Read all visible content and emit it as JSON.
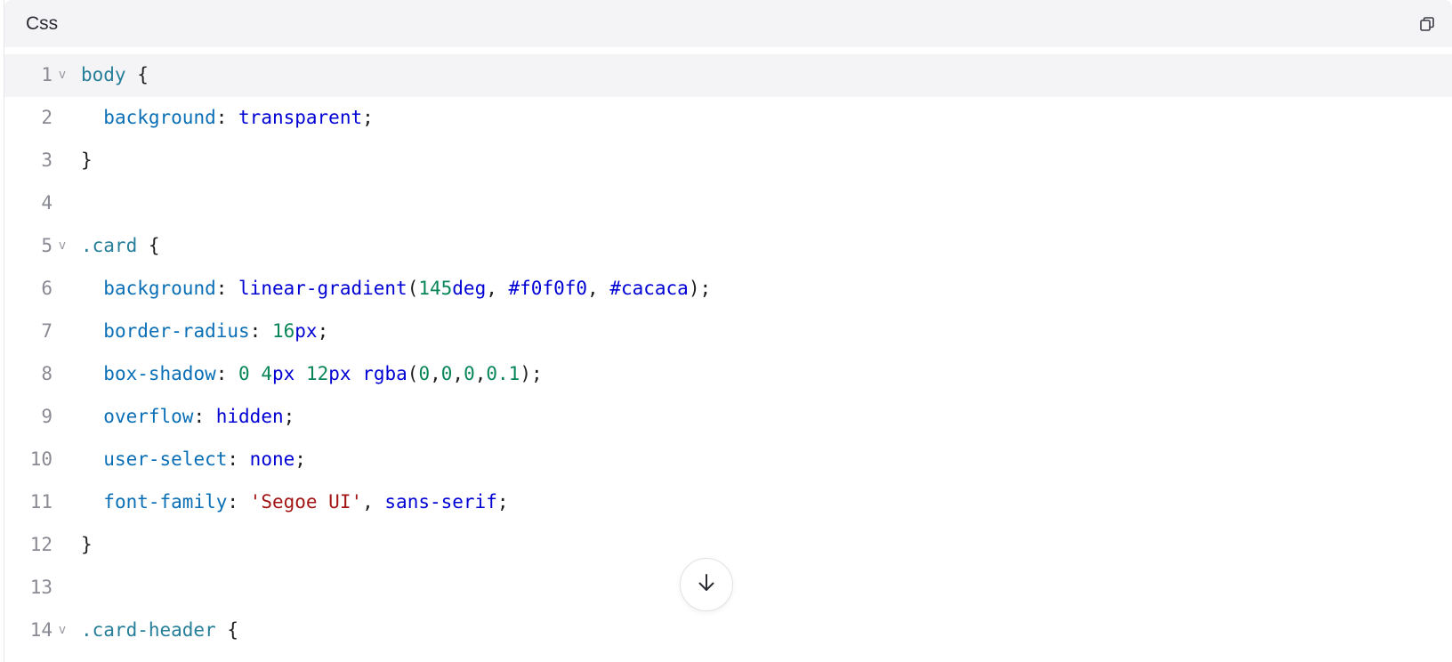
{
  "header": {
    "language": "Css",
    "copy_icon": "copy-icon"
  },
  "code": {
    "active_line": 1,
    "lines": [
      {
        "n": "1",
        "fold": true,
        "tokens": [
          [
            "sel",
            "body"
          ],
          [
            "pl",
            " {"
          ]
        ]
      },
      {
        "n": "2",
        "fold": false,
        "tokens": [
          [
            "pl",
            "  "
          ],
          [
            "prop",
            "background"
          ],
          [
            "pl",
            ": "
          ],
          [
            "kw",
            "transparent"
          ],
          [
            "pl",
            ";"
          ]
        ]
      },
      {
        "n": "3",
        "fold": false,
        "tokens": [
          [
            "pl",
            "}"
          ]
        ]
      },
      {
        "n": "4",
        "fold": false,
        "tokens": []
      },
      {
        "n": "5",
        "fold": true,
        "tokens": [
          [
            "sel",
            ".card"
          ],
          [
            "pl",
            " {"
          ]
        ]
      },
      {
        "n": "6",
        "fold": false,
        "tokens": [
          [
            "pl",
            "  "
          ],
          [
            "prop",
            "background"
          ],
          [
            "pl",
            ": "
          ],
          [
            "kw",
            "linear-gradient"
          ],
          [
            "pl",
            "("
          ],
          [
            "num",
            "145"
          ],
          [
            "kw",
            "deg"
          ],
          [
            "pl",
            ", "
          ],
          [
            "kw",
            "#f0f0f0"
          ],
          [
            "pl",
            ", "
          ],
          [
            "kw",
            "#cacaca"
          ],
          [
            "pl",
            ");"
          ]
        ]
      },
      {
        "n": "7",
        "fold": false,
        "tokens": [
          [
            "pl",
            "  "
          ],
          [
            "prop",
            "border-radius"
          ],
          [
            "pl",
            ": "
          ],
          [
            "num",
            "16"
          ],
          [
            "kw",
            "px"
          ],
          [
            "pl",
            ";"
          ]
        ]
      },
      {
        "n": "8",
        "fold": false,
        "tokens": [
          [
            "pl",
            "  "
          ],
          [
            "prop",
            "box-shadow"
          ],
          [
            "pl",
            ": "
          ],
          [
            "num",
            "0"
          ],
          [
            "pl",
            " "
          ],
          [
            "num",
            "4"
          ],
          [
            "kw",
            "px"
          ],
          [
            "pl",
            " "
          ],
          [
            "num",
            "12"
          ],
          [
            "kw",
            "px"
          ],
          [
            "pl",
            " "
          ],
          [
            "kw",
            "rgba"
          ],
          [
            "pl",
            "("
          ],
          [
            "num",
            "0"
          ],
          [
            "pl",
            ","
          ],
          [
            "num",
            "0"
          ],
          [
            "pl",
            ","
          ],
          [
            "num",
            "0"
          ],
          [
            "pl",
            ","
          ],
          [
            "num",
            "0.1"
          ],
          [
            "pl",
            ");"
          ]
        ]
      },
      {
        "n": "9",
        "fold": false,
        "tokens": [
          [
            "pl",
            "  "
          ],
          [
            "prop",
            "overflow"
          ],
          [
            "pl",
            ": "
          ],
          [
            "kw",
            "hidden"
          ],
          [
            "pl",
            ";"
          ]
        ]
      },
      {
        "n": "10",
        "fold": false,
        "tokens": [
          [
            "pl",
            "  "
          ],
          [
            "prop",
            "user-select"
          ],
          [
            "pl",
            ": "
          ],
          [
            "kw",
            "none"
          ],
          [
            "pl",
            ";"
          ]
        ]
      },
      {
        "n": "11",
        "fold": false,
        "tokens": [
          [
            "pl",
            "  "
          ],
          [
            "prop",
            "font-family"
          ],
          [
            "pl",
            ": "
          ],
          [
            "str",
            "'Segoe UI'"
          ],
          [
            "pl",
            ", "
          ],
          [
            "kw",
            "sans-serif"
          ],
          [
            "pl",
            ";"
          ]
        ]
      },
      {
        "n": "12",
        "fold": false,
        "tokens": [
          [
            "pl",
            "}"
          ]
        ]
      },
      {
        "n": "13",
        "fold": false,
        "tokens": []
      },
      {
        "n": "14",
        "fold": true,
        "tokens": [
          [
            "sel",
            ".card-header"
          ],
          [
            "pl",
            " {"
          ]
        ]
      }
    ]
  },
  "fold_glyph": "v",
  "scroll_button_icon": "arrow-down-icon"
}
